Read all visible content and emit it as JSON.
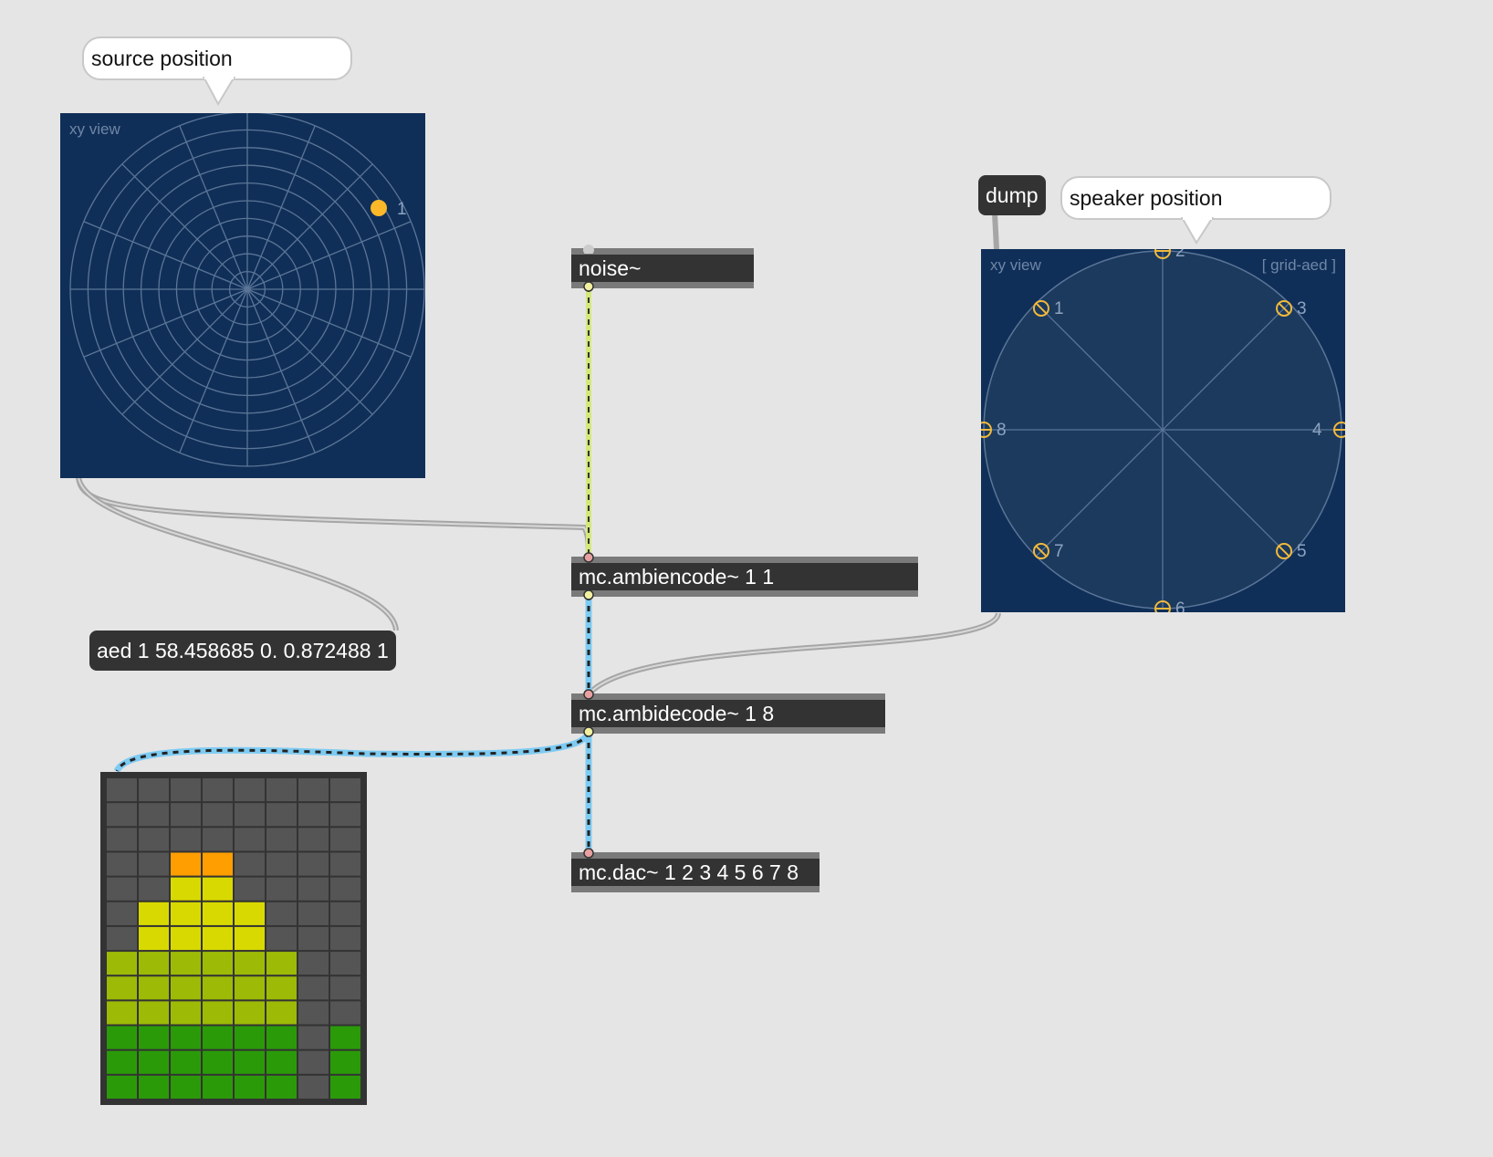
{
  "comments": {
    "source_position": "source position",
    "speaker_position": "speaker position"
  },
  "objects": {
    "noise": "noise~",
    "encoder": "mc.ambiencode~ 1 1",
    "decoder": "mc.ambidecode~ 1 8",
    "dac": "mc.dac~ 1 2 3 4 5 6 7 8"
  },
  "messages": {
    "dump": "dump",
    "aed": "aed 1 58.458685 0. 0.872488 1"
  },
  "source_view": {
    "label": "xy view",
    "source_label": "1",
    "source_color": "#fbb829",
    "grid_color": "#5b7597"
  },
  "speaker_view": {
    "label": "xy view",
    "mode_label": "[ grid-aed ]",
    "speaker_color": "#f2b93b",
    "speakers": [
      "1",
      "2",
      "3",
      "4",
      "5",
      "6",
      "7",
      "8"
    ]
  },
  "meter": {
    "columns": 8,
    "rows": 13,
    "levels": [
      6,
      8,
      10,
      10,
      8,
      6,
      0,
      3
    ],
    "colors": {
      "off": "#555555",
      "green": "#2a9a09",
      "olive": "#9dba06",
      "yellow": "#d8d900",
      "orange": "#ff9e00"
    }
  },
  "cord_colors": {
    "control": "#a9a9a9",
    "signal_noise": "#d3e87a",
    "signal_mc": "#7ecbf2"
  }
}
